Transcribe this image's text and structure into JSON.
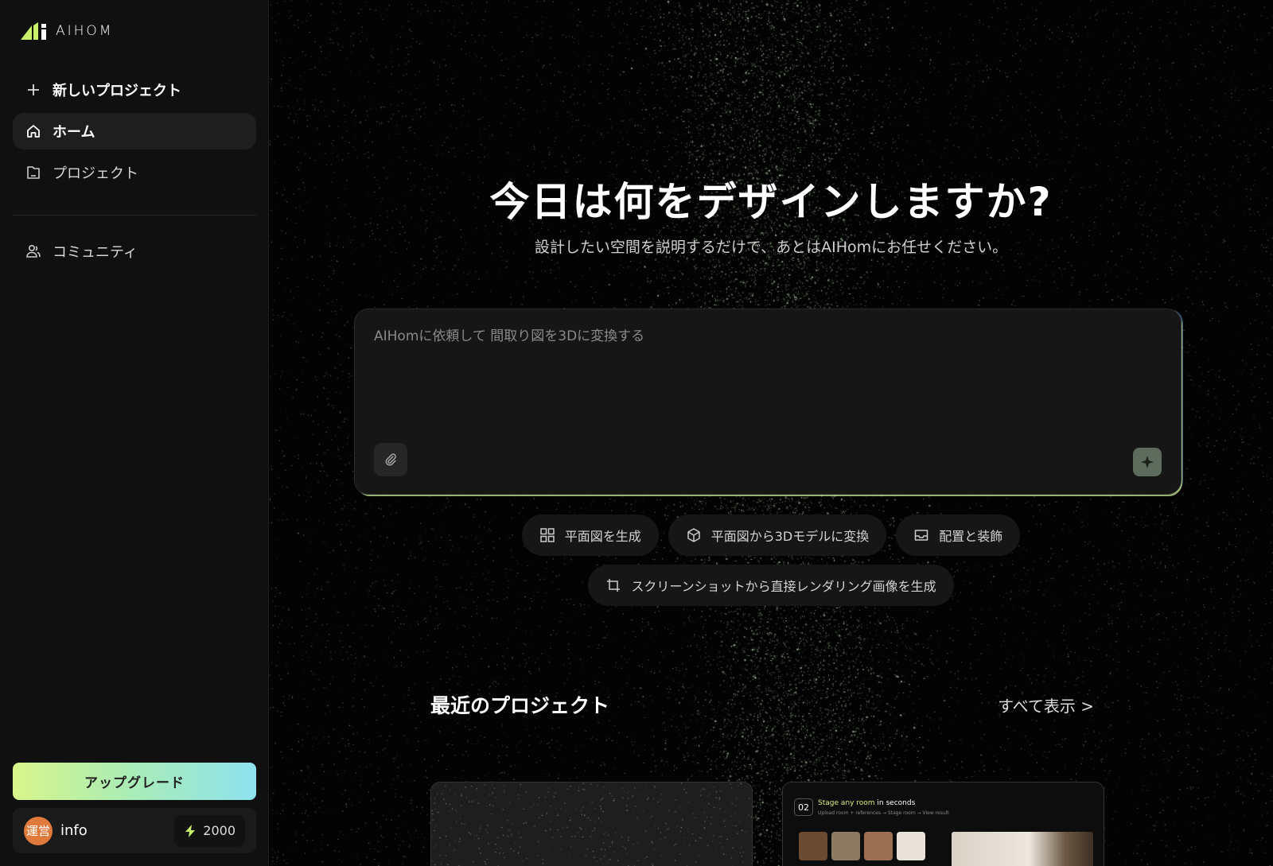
{
  "sidebar": {
    "logo_text": "AIHOM",
    "nav": [
      {
        "label": "新しいプロジェクト",
        "icon": "plus-icon"
      },
      {
        "label": "ホーム",
        "icon": "home-icon"
      },
      {
        "label": "プロジェクト",
        "icon": "folder-icon"
      },
      {
        "label": "コミュニティ",
        "icon": "community-icon"
      }
    ],
    "upgrade_label": "アップグレード",
    "user": {
      "avatar_text": "運営",
      "name": "info",
      "credits": "2000"
    }
  },
  "hero": {
    "title": "今日は何をデザインしますか?",
    "subtitle": "設計したい空間を説明するだけで、あとはAIHomにお任せください。"
  },
  "prompt": {
    "placeholder": "AIHomに依頼して 間取り図を3Dに変換する"
  },
  "chips": [
    {
      "label": "平面図を生成",
      "icon": "grid-icon"
    },
    {
      "label": "平面図から3Dモデルに変換",
      "icon": "cube-icon"
    },
    {
      "label": "配置と装飾",
      "icon": "inbox-icon"
    },
    {
      "label": "スクリーンショットから直接レンダリング画像を生成",
      "icon": "crop-icon"
    }
  ],
  "recent": {
    "title": "最近のプロジェクト",
    "view_all": "すべて表示 >",
    "card_b": {
      "num": "02",
      "caption_highlight": "Stage any room",
      "caption_rest": " in seconds",
      "caption_sub": "Upload room + references → Stage room → View result"
    }
  },
  "colors": {
    "accent_gradient": [
      "#d8f58a",
      "#8ee2ee"
    ],
    "avatar": "#e07a3a",
    "star": "#c8f0c0"
  }
}
